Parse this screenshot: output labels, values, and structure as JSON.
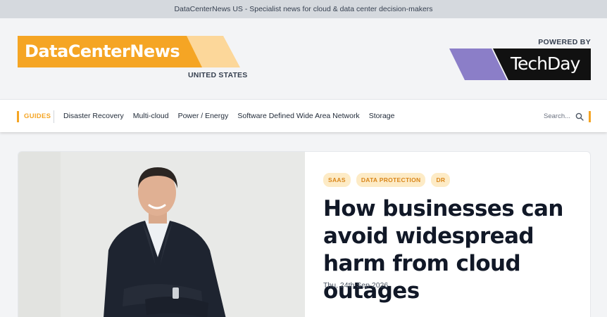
{
  "topbar": {
    "text": "DataCenterNews US - Specialist news for cloud & data center decision-makers"
  },
  "header": {
    "logo_text": "DataCenterNews",
    "logo_subtitle": "UNITED STATES",
    "powered_by": "POWERED BY",
    "partner_logo_text": "TechDay",
    "colors": {
      "brand": "#f5a524",
      "brand_light": "#fcd79a",
      "partner_bg": "#111111",
      "partner_accent": "#8b7ec8"
    }
  },
  "nav": {
    "guides_label": "GUIDES",
    "items": [
      "Disaster Recovery",
      "Multi-cloud",
      "Power / Energy",
      "Software Defined Wide Area Network",
      "Storage"
    ],
    "search_placeholder": "Search...",
    "search_icon": "search-icon"
  },
  "article": {
    "tags": [
      "SAAS",
      "DATA PROTECTION",
      "DR"
    ],
    "headline": "How businesses can avoid widespread harm from cloud outages",
    "date": "Thu, 24th Sep 2026"
  }
}
